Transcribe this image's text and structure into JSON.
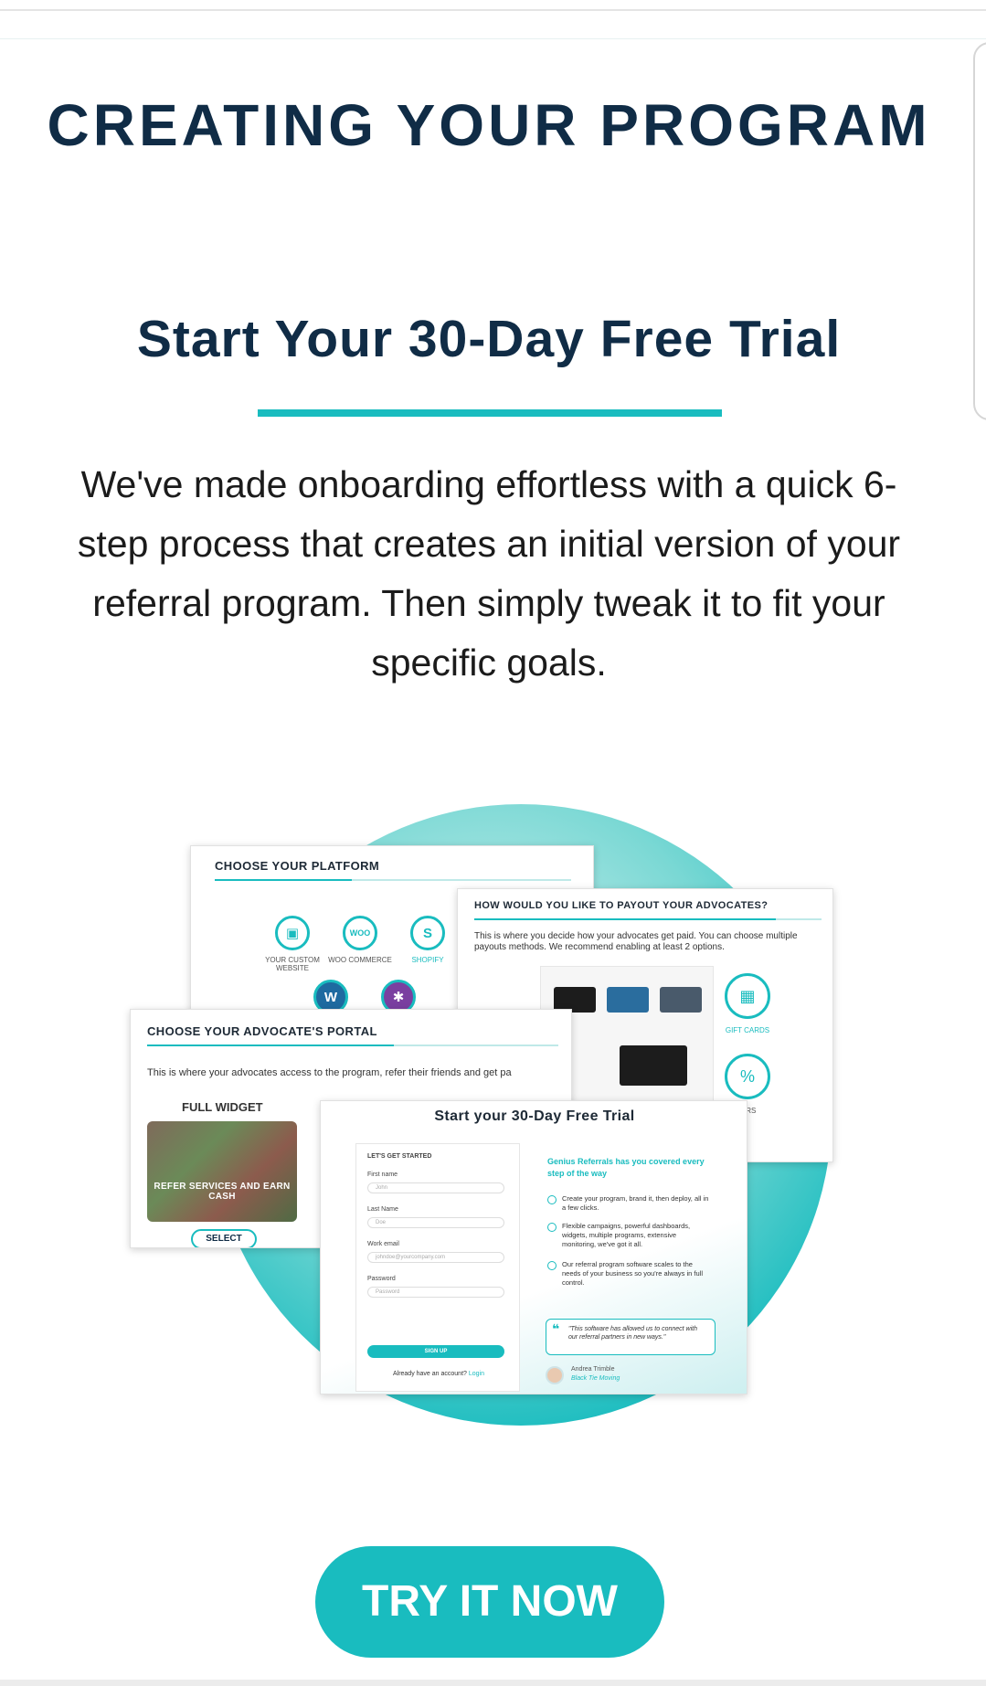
{
  "heading": "CREATING YOUR PROGRAM",
  "subheading": "Start Your 30-Day Free Trial",
  "description": "We've made onboarding effortless with a quick 6-step process that creates an initial version of your referral program. Then simply tweak it to fit your specific goals.",
  "illustration": {
    "platform_card": {
      "title": "CHOOSE YOUR PLATFORM",
      "items": [
        "YOUR CUSTOM WEBSITE",
        "WOO COMMERCE",
        "SHOPIFY"
      ]
    },
    "payout_card": {
      "title": "HOW WOULD YOU LIKE TO PAYOUT YOUR ADVOCATES?",
      "text": "This is where you decide how your advocates get paid. You can choose multiple payouts methods. We recommend enabling at least 2 options.",
      "gift_cards_label": "GIFT CARDS",
      "partial_label": "IERS"
    },
    "portal_card": {
      "title": "CHOOSE YOUR ADVOCATE'S PORTAL",
      "text": "This is where your advocates access to the program, refer their friends and get pa",
      "widget_label": "FULL WIDGET",
      "banner": "REFER SERVICES AND EARN CASH",
      "select_label": "SELECT"
    },
    "trial_card": {
      "title": "Start your 30-Day Free Trial",
      "form_title": "LET'S GET STARTED",
      "fields": [
        {
          "label": "First name",
          "placeholder": "John"
        },
        {
          "label": "Last Name",
          "placeholder": "Doe"
        },
        {
          "label": "Work email",
          "placeholder": "johndoe@yourcompany.com"
        },
        {
          "label": "Password",
          "placeholder": "Password"
        }
      ],
      "signup_label": "SIGN UP",
      "login_prompt": "Already have an account?",
      "login_link": "Login",
      "aside_title": "Genius Referrals has you covered every step of the way",
      "bullets": [
        "Create your program, brand it, then deploy, all in a few clicks.",
        "Flexible campaigns, powerful dashboards, widgets, multiple programs, extensive monitoring, we've got it all.",
        "Our referral program software scales to the needs of your business so you're always in full control."
      ],
      "quote": "\"This software has allowed us to connect with our referral partners in new ways.\"",
      "quote_author": "Andrea Trimble",
      "quote_company": "Black Tie Moving"
    }
  },
  "cta_label": "TRY IT NOW",
  "colors": {
    "navy": "#102c46",
    "teal": "#19bcbf",
    "text": "#1b1b1b"
  }
}
